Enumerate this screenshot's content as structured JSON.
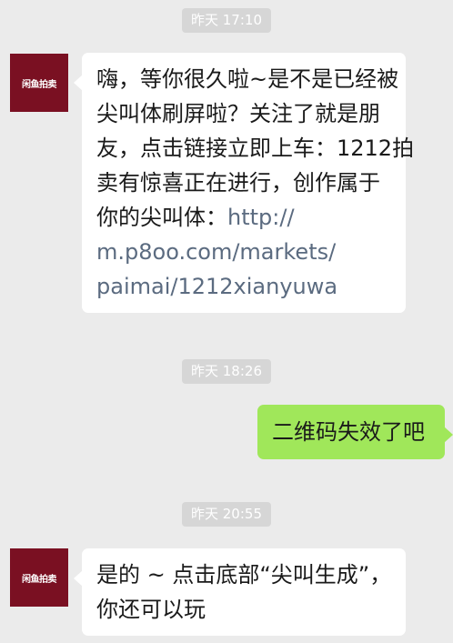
{
  "messages": [
    {
      "timestamp": "昨天 17:10"
    },
    {
      "sender": "闲鱼拍卖",
      "lines": [
        "嗨，等你很久啦~是不是已经被",
        "尖叫体刷屏啦？关注了就是朋",
        "友，点击链接立即上车：1212拍",
        "卖有惊喜正在进行，创作属于"
      ],
      "line_prefix": "你的尖叫体：",
      "link_lines": [
        "http://",
        "m.p8oo.com/markets/",
        "paimai/1212xianyuwa"
      ]
    },
    {
      "timestamp": "昨天 18:26"
    },
    {
      "sender": "me",
      "text": "二维码失效了吧"
    },
    {
      "timestamp": "昨天 20:55"
    },
    {
      "sender": "闲鱼拍卖",
      "lines": [
        "是的 ~ 点击底部“尖叫生成”，",
        "你还可以玩"
      ]
    }
  ]
}
